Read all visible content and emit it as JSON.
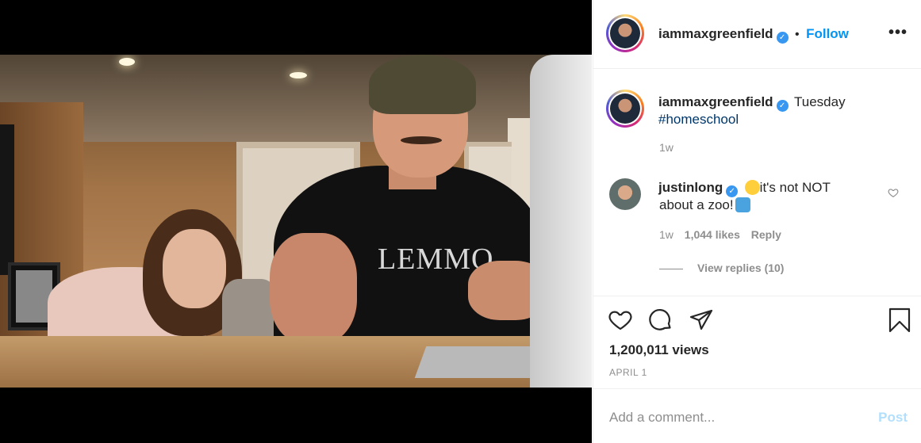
{
  "post": {
    "author": "iammaxgreenfield",
    "follow_label": "Follow",
    "separator": "•",
    "more_label": "•••",
    "verified_mark": "✓",
    "caption": {
      "username": "iammaxgreenfield",
      "text": "Tuesday",
      "hashtag": "#homeschool",
      "age": "1w"
    },
    "video": {
      "shirt_text": "LEMMO"
    },
    "comments": [
      {
        "username": "justinlong",
        "text_part1": "it's not NOT",
        "text_part2": "about a zoo!",
        "emoji_1": "grinning-sweat-emoji",
        "emoji_2": "person-shrugging-emoji",
        "age": "1w",
        "likes": "1,044 likes",
        "reply_label": "Reply",
        "view_replies": "View replies (10)"
      }
    ],
    "views": "1,200,011 views",
    "date": "APRIL 1",
    "comment_placeholder": "Add a comment...",
    "post_label": "Post"
  },
  "colors": {
    "link_blue": "#0095f6",
    "verified_blue": "#3897f0",
    "hashtag": "#00376b",
    "muted": "#8e8e8e",
    "post_disabled": "#b2dffc"
  },
  "icons": [
    "heart-icon",
    "comment-icon",
    "share-icon",
    "bookmark-icon",
    "more-options-icon",
    "verified-badge-icon",
    "small-heart-icon"
  ]
}
